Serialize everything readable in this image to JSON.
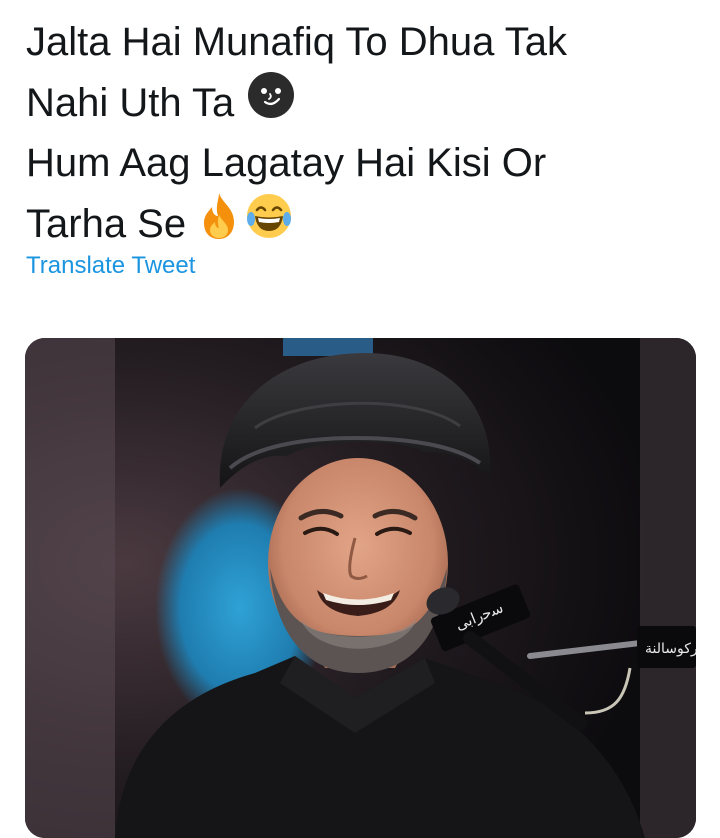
{
  "tweet": {
    "lines": [
      "Jalta Hai Munafiq To Dhua Tak",
      "Nahi Uth Ta",
      "Hum Aag Lagatay Hai Kisi Or",
      "Tarha Se"
    ],
    "emojis": [
      "dark-smirk-face-icon",
      "fire-icon",
      "laughing-face-icon"
    ]
  },
  "translate_label": "Translate Tweet",
  "colors": {
    "text": "#14171a",
    "link": "#1b95e0",
    "background": "#ffffff"
  },
  "media": {
    "kind": "photo",
    "subject": "smiling man in black turban and black robe speaking at microphones",
    "mic_labels": [
      "ﺳﺣﺭﺍﺑﻰ",
      "ﻭﺭﻛﻮﺳﺎﻟﻨﺔ"
    ]
  }
}
